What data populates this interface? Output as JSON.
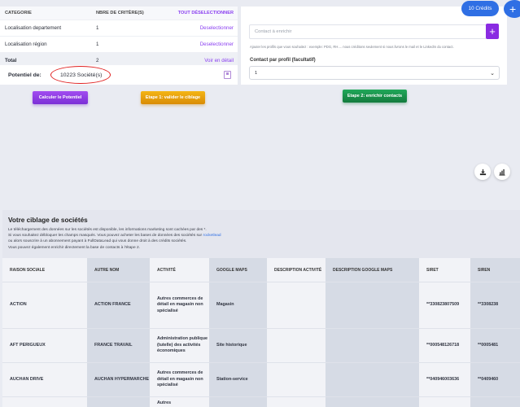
{
  "criteria": {
    "headers": {
      "category": "CATEGORIE",
      "count": "NBRE DE CRITÈRE(S)",
      "action": "TOUT DÉSELECTIONNER"
    },
    "rows": [
      {
        "category": "Localisation departement",
        "count": "1",
        "action": "Deselectionner"
      },
      {
        "category": "Localisation région",
        "count": "1",
        "action": "Deselectionner"
      }
    ],
    "total": {
      "label": "Total",
      "count": "2",
      "action": "Voir en détail"
    }
  },
  "potentiel": {
    "label": "Potentiel de:",
    "value": "10223 Société(s)"
  },
  "buttons": {
    "calc": "Calculer le Potentiel",
    "etape1": "Etape 1: valider le ciblage",
    "etape2": "Etape 2: enrichir contacts"
  },
  "enrich": {
    "placeholder": "Contact à enrichir",
    "add": "+",
    "help": "Ajouter les profils que vous souhaitez : exemple: PDG, RH.... nous créditons seulement si nous livrons le mail et le LinkedIn du contact.",
    "contact_label": "Contact par profil (facultatif)",
    "contact_value": "1"
  },
  "credits": "10 Crédits",
  "fab": "+",
  "ciblage": {
    "title": "Votre ciblage de sociétés",
    "lines": [
      "Le téléchargement des données sur les sociétés est disponible, les informations marketing sont cachées par des *.",
      "Si vous souhaitez débloquer les champs masqués. Vous pouvez acheter les bases de données des sociétés sur ",
      "ou alors souscrire à un abonnement payant à FullDataLead qui vous donne droit à des crédits sociétés.",
      "Vous pouvez également enrichir directement la base de contacts à l'étape 2."
    ],
    "link": "rocketlead"
  },
  "table": {
    "columns": [
      "RAISON SOCIALE",
      "AUTRE NOM",
      "ACTIVITÉ",
      "GOOGLE MAPS",
      "DESCRIPTION ACTIVITÉ",
      "DESCRIPTION GOOGLE MAPS",
      "SIRET",
      "SIREN"
    ],
    "rows": [
      [
        "ACTION",
        "ACTION FRANCE",
        "Autres commerces de détail en magasin non spécialisé",
        "Magasin",
        "",
        "",
        "**330823807509",
        "**3308238"
      ],
      [
        "AFT PERIGUEUX",
        "FRANCE TRAVAIL",
        "Administration publique (tutelle) des activités économiques",
        "Site historique",
        "",
        "",
        "**000548126718",
        "**0005481"
      ],
      [
        "AUCHAN DRIVE",
        "AUCHAN HYPERMARCHE",
        "Autres commerces de détail en magasin non spécialisé",
        "Station-service",
        "",
        "",
        "**040946003636",
        "**0409460"
      ],
      [
        "",
        "",
        "Autres",
        "",
        "",
        "",
        "",
        ""
      ]
    ]
  }
}
